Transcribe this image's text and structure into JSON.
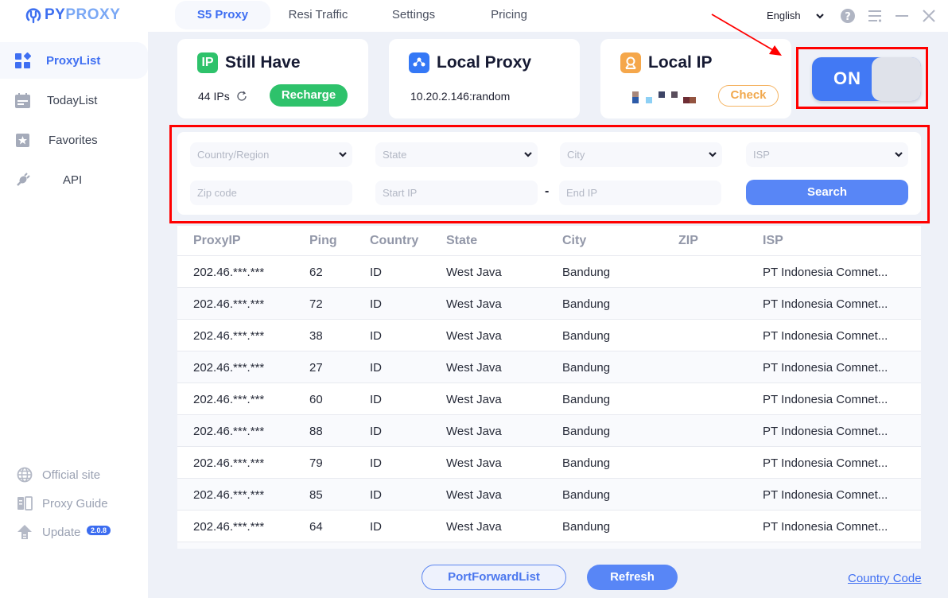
{
  "app": {
    "logo_part1": "PY",
    "logo_part2": "PROXY",
    "brand_color": "#3f6ff2"
  },
  "nav": {
    "tabs": [
      {
        "label": "S5 Proxy",
        "active": true
      },
      {
        "label": "Resi Traffic",
        "active": false
      },
      {
        "label": "Settings",
        "active": false
      },
      {
        "label": "Pricing",
        "active": false
      }
    ],
    "language": "English",
    "icons": [
      "help-icon",
      "menu-icon",
      "minimize-icon",
      "close-icon"
    ]
  },
  "sidebar": {
    "items": [
      {
        "label": "ProxyList",
        "icon": "grid-icon",
        "active": true
      },
      {
        "label": "TodayList",
        "icon": "calendar-icon",
        "active": false
      },
      {
        "label": "Favorites",
        "icon": "star-icon",
        "active": false
      },
      {
        "label": "API",
        "icon": "plug-icon",
        "active": false
      }
    ],
    "bottom": [
      {
        "label": "Official site",
        "icon": "globe-icon"
      },
      {
        "label": "Proxy Guide",
        "icon": "book-icon"
      },
      {
        "label": "Update",
        "icon": "upload-icon",
        "badge": "2.0.8"
      }
    ]
  },
  "cards": {
    "still_have": {
      "title": "Still Have",
      "icon_text": "IP",
      "count": "44 IPs",
      "button": "Recharge"
    },
    "local_proxy": {
      "title": "Local Proxy",
      "value": "10.20.2.146:random"
    },
    "local_ip": {
      "title": "Local IP",
      "button": "Check"
    }
  },
  "toggle": {
    "label": "ON",
    "state": true
  },
  "filters": {
    "country": "Country/Region",
    "state": "State",
    "city": "City",
    "isp": "ISP",
    "zip_placeholder": "Zip code",
    "start_ip_placeholder": "Start IP",
    "separator": "-",
    "end_ip_placeholder": "End IP",
    "search_button": "Search"
  },
  "table": {
    "columns": [
      "ProxyIP",
      "Ping",
      "Country",
      "State",
      "City",
      "ZIP",
      "ISP"
    ],
    "rows": [
      [
        "202.46.***.***",
        "62",
        "ID",
        "West Java",
        "Bandung",
        "",
        "PT Indonesia Comnet..."
      ],
      [
        "202.46.***.***",
        "72",
        "ID",
        "West Java",
        "Bandung",
        "",
        "PT Indonesia Comnet..."
      ],
      [
        "202.46.***.***",
        "38",
        "ID",
        "West Java",
        "Bandung",
        "",
        "PT Indonesia Comnet..."
      ],
      [
        "202.46.***.***",
        "27",
        "ID",
        "West Java",
        "Bandung",
        "",
        "PT Indonesia Comnet..."
      ],
      [
        "202.46.***.***",
        "60",
        "ID",
        "West Java",
        "Bandung",
        "",
        "PT Indonesia Comnet..."
      ],
      [
        "202.46.***.***",
        "88",
        "ID",
        "West Java",
        "Bandung",
        "",
        "PT Indonesia Comnet..."
      ],
      [
        "202.46.***.***",
        "79",
        "ID",
        "West Java",
        "Bandung",
        "",
        "PT Indonesia Comnet..."
      ],
      [
        "202.46.***.***",
        "85",
        "ID",
        "West Java",
        "Bandung",
        "",
        "PT Indonesia Comnet..."
      ],
      [
        "202.46.***.***",
        "64",
        "ID",
        "West Java",
        "Bandung",
        "",
        "PT Indonesia Comnet..."
      ]
    ]
  },
  "footer": {
    "port_forward": "PortForwardList",
    "refresh": "Refresh",
    "country_code": "Country Code"
  },
  "annotation": {
    "highlight_color": "#ff0000"
  }
}
